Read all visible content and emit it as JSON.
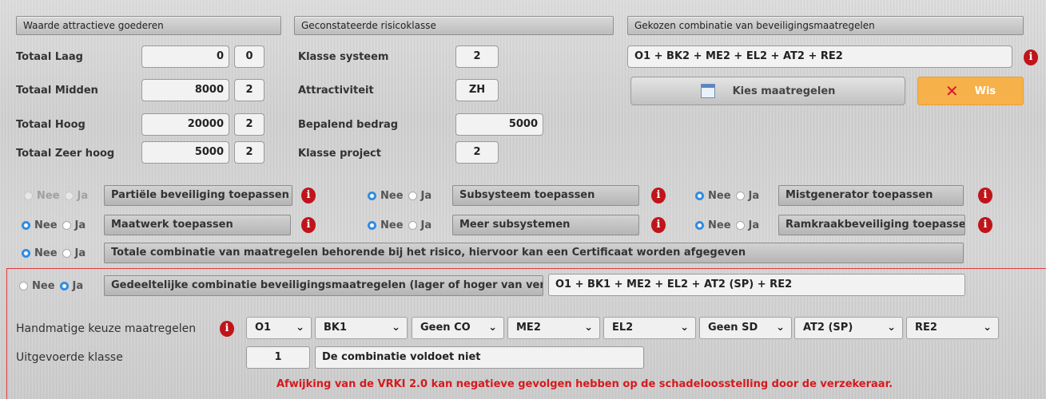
{
  "headers": {
    "waarde": "Waarde attractieve goederen",
    "risico": "Geconstateerde risicoklasse",
    "combinatie": "Gekozen combinatie van beveiligingsmaatregelen"
  },
  "waarde_rows": [
    {
      "label": "Totaal Laag",
      "amount": "0",
      "class": "0"
    },
    {
      "label": "Totaal Midden",
      "amount": "8000",
      "class": "2"
    },
    {
      "label": "Totaal Hoog",
      "amount": "20000",
      "class": "2"
    },
    {
      "label": "Totaal Zeer hoog",
      "amount": "5000",
      "class": "2"
    }
  ],
  "risico_rows": [
    {
      "label": "Klasse systeem",
      "value": "2"
    },
    {
      "label": "Attractiviteit",
      "value": "ZH"
    },
    {
      "label": "Bepalend bedrag",
      "value": "5000"
    },
    {
      "label": "Klasse project",
      "value": "2"
    }
  ],
  "combinatie_value": "O1 + BK2 + ME2 + EL2 + AT2 + RE2",
  "buttons": {
    "kies": "Kies maatregelen",
    "wis": "Wis"
  },
  "radio_labels": {
    "nee": "Nee",
    "ja": "Ja"
  },
  "options": [
    {
      "label": "Partiële beveiliging toepassen",
      "selected": "none",
      "disabled": true
    },
    {
      "label": "Subsysteem toepassen",
      "selected": "nee"
    },
    {
      "label": "Mistgenerator toepassen",
      "selected": "nee"
    },
    {
      "label": "Maatwerk toepassen",
      "selected": "nee"
    },
    {
      "label": "Meer subsystemen",
      "selected": "nee"
    },
    {
      "label": "Ramkraakbeveiliging toepassen",
      "selected": "nee"
    },
    {
      "label": "Totale combinatie van maatregelen behorende bij het risico, hiervoor kan een Certificaat worden afgegeven",
      "selected": "nee"
    },
    {
      "label": "Gedeeltelijke combinatie beveiligingsmaatregelen (lager of hoger van vereist):",
      "selected": "ja"
    }
  ],
  "gedeeltelijk_value": "O1 + BK1 + ME2 + EL2 + AT2 (SP) + RE2",
  "handmatig": {
    "label": "Handmatige keuze maatregelen",
    "selects": [
      "O1",
      "BK1",
      "Geen CO",
      "ME2",
      "EL2",
      "Geen SD",
      "AT2 (SP)",
      "RE2"
    ]
  },
  "uitgevoerd": {
    "label": "Uitgevoerde klasse",
    "value": "1",
    "status": "De combinatie voldoet niet"
  },
  "warning": "Afwijking van de VRKI 2.0 kan negatieve gevolgen hebben op de schadeloosstelling door de verzekeraar.",
  "colors": {
    "accent_blue": "#2f8ce0",
    "info_red": "#c0141b",
    "wis_orange": "#f6b14a",
    "warning_red": "#d7191d"
  }
}
